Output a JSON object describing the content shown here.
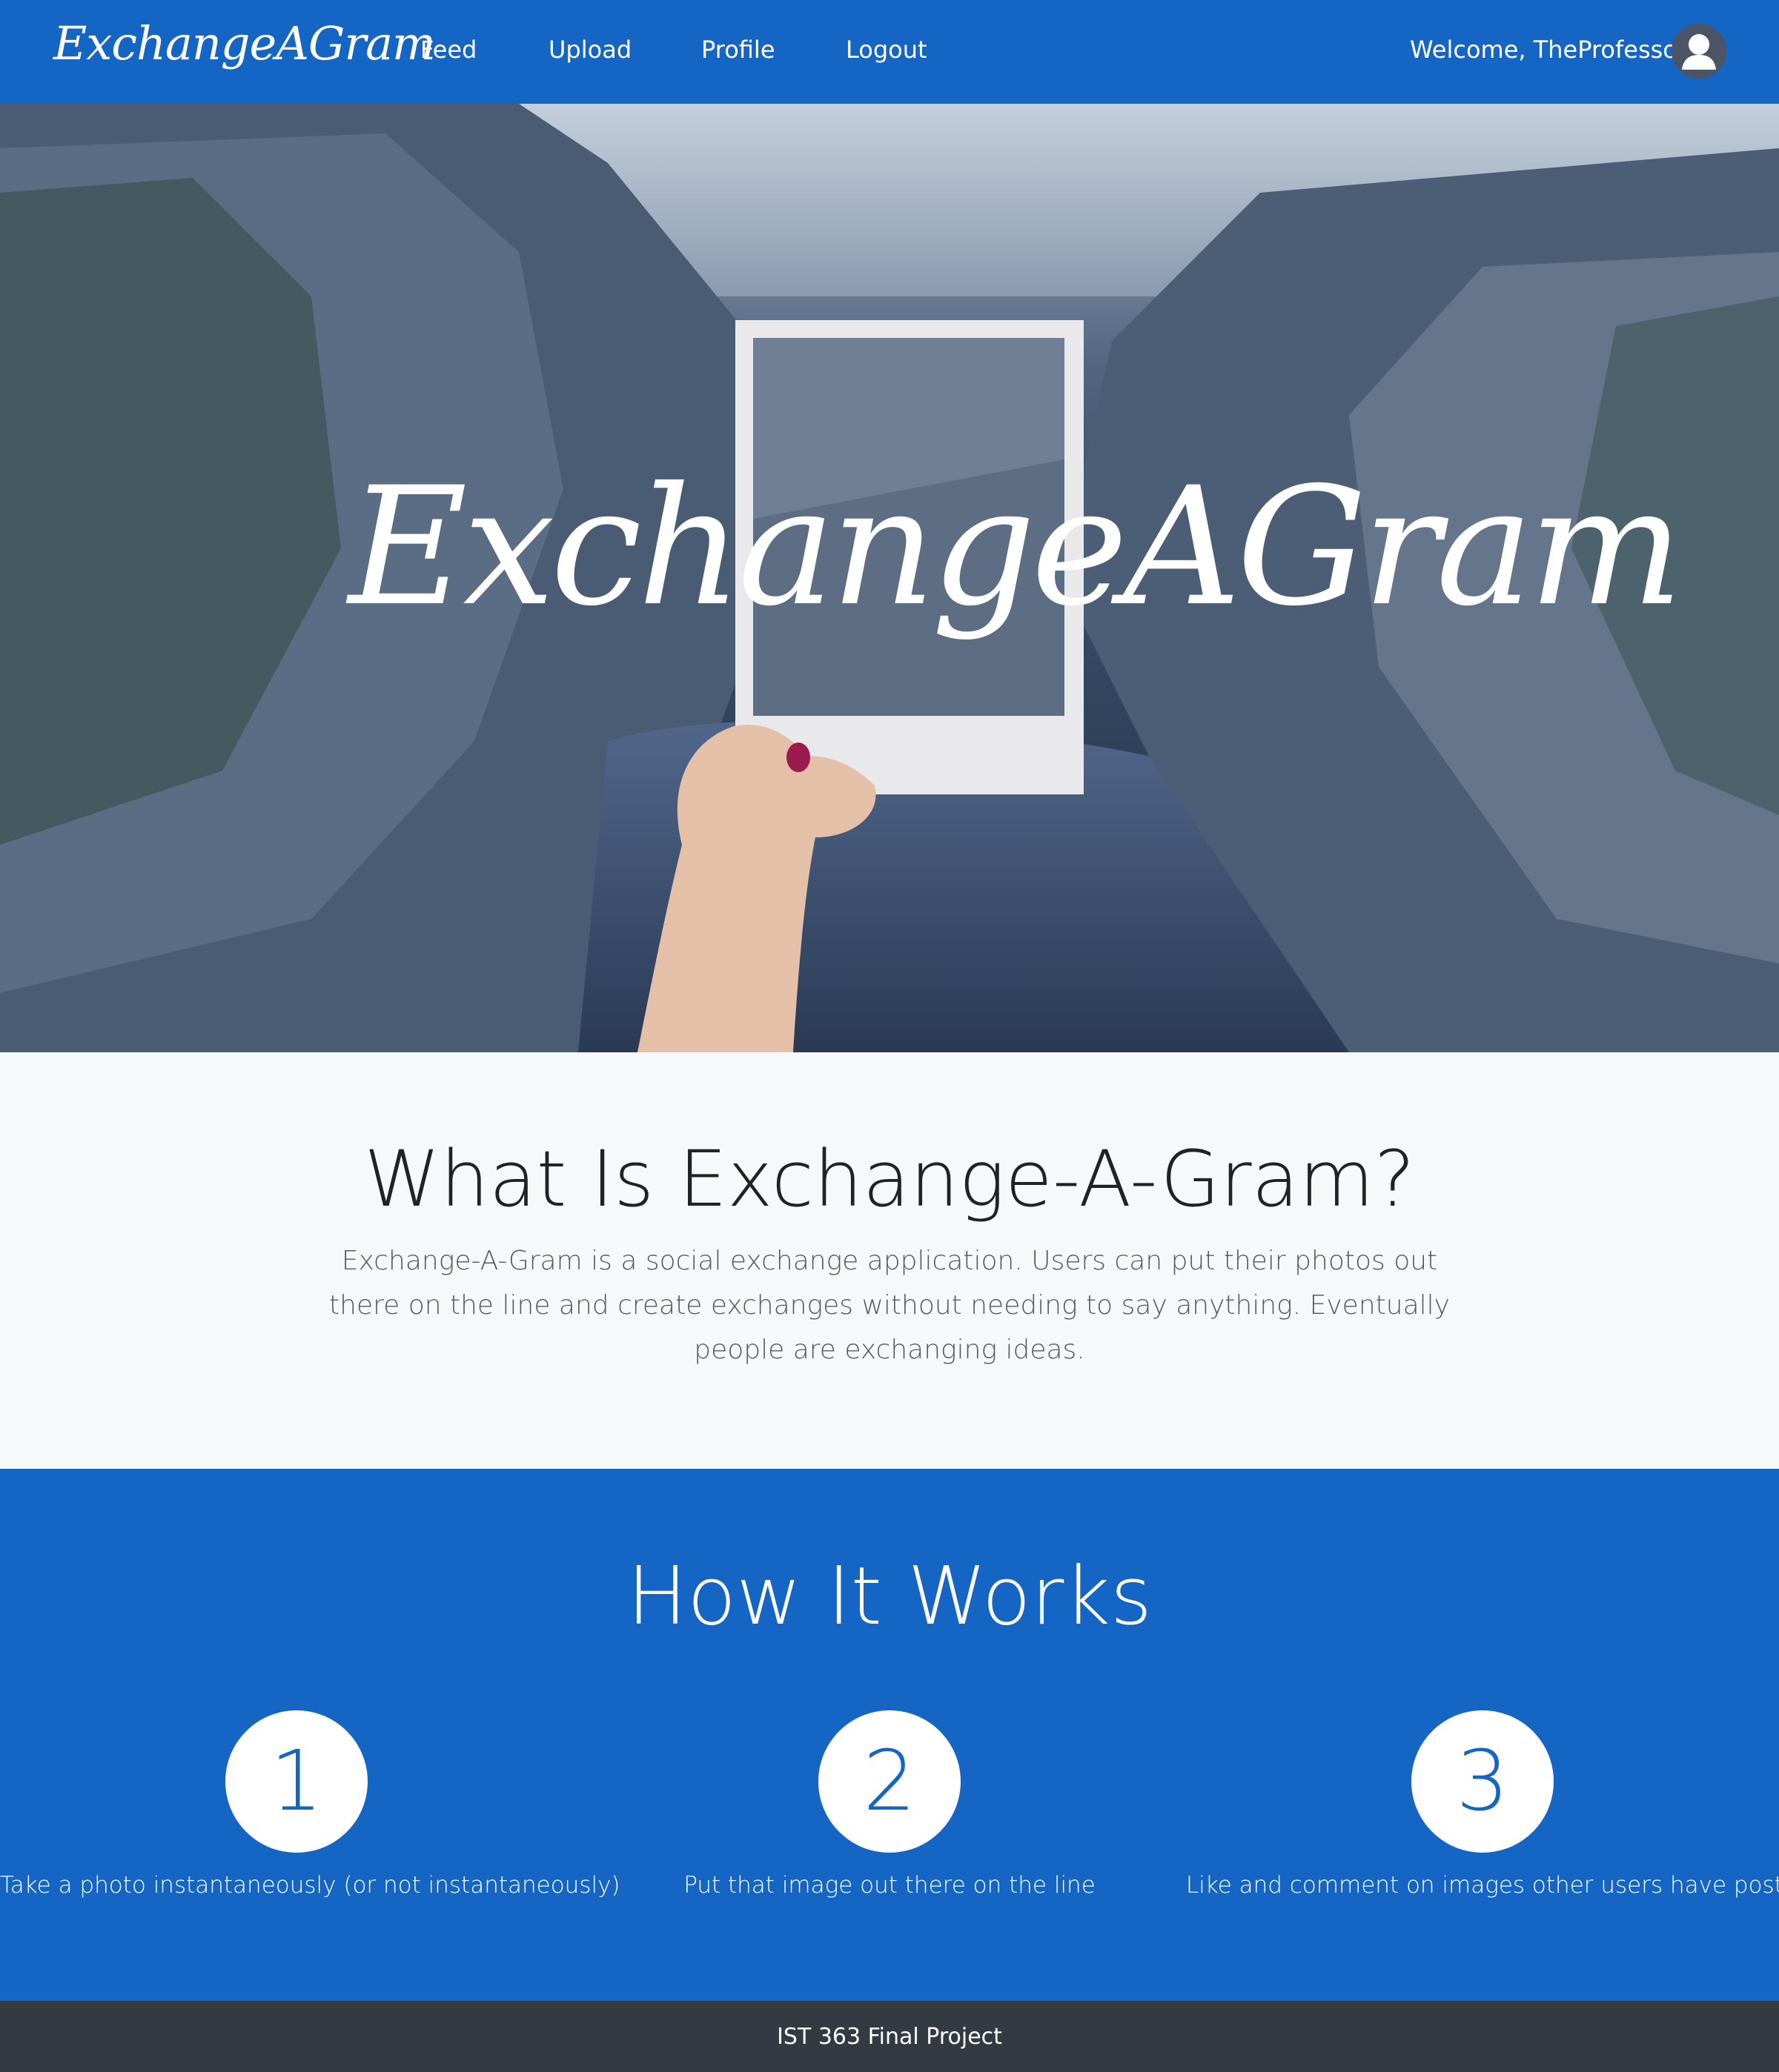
{
  "navbar": {
    "brand": "ExchangeAGram",
    "links": [
      {
        "label": "Feed"
      },
      {
        "label": "Upload"
      },
      {
        "label": "Profile"
      },
      {
        "label": "Logout"
      }
    ],
    "welcome": "Welcome, TheProfessor",
    "avatar_icon": "user-avatar-icon",
    "color": "#1565c4"
  },
  "hero": {
    "title": "ExchangeAGram"
  },
  "about": {
    "heading": "What Is Exchange-A-Gram?",
    "text": "Exchange-A-Gram is a social exchange application. Users can put their photos out there on the line and create exchanges without needing to say anything. Eventually people are exchanging ideas."
  },
  "how": {
    "heading": "How It Works",
    "steps": [
      {
        "number": "1",
        "text": "Take a photo instantaneously (or not instantaneously)"
      },
      {
        "number": "2",
        "text": "Put that image out there on the line"
      },
      {
        "number": "3",
        "text": "Like and comment on images other users have posted"
      }
    ]
  },
  "footer": {
    "text": "IST 363 Final Project",
    "color": "#343a42"
  }
}
